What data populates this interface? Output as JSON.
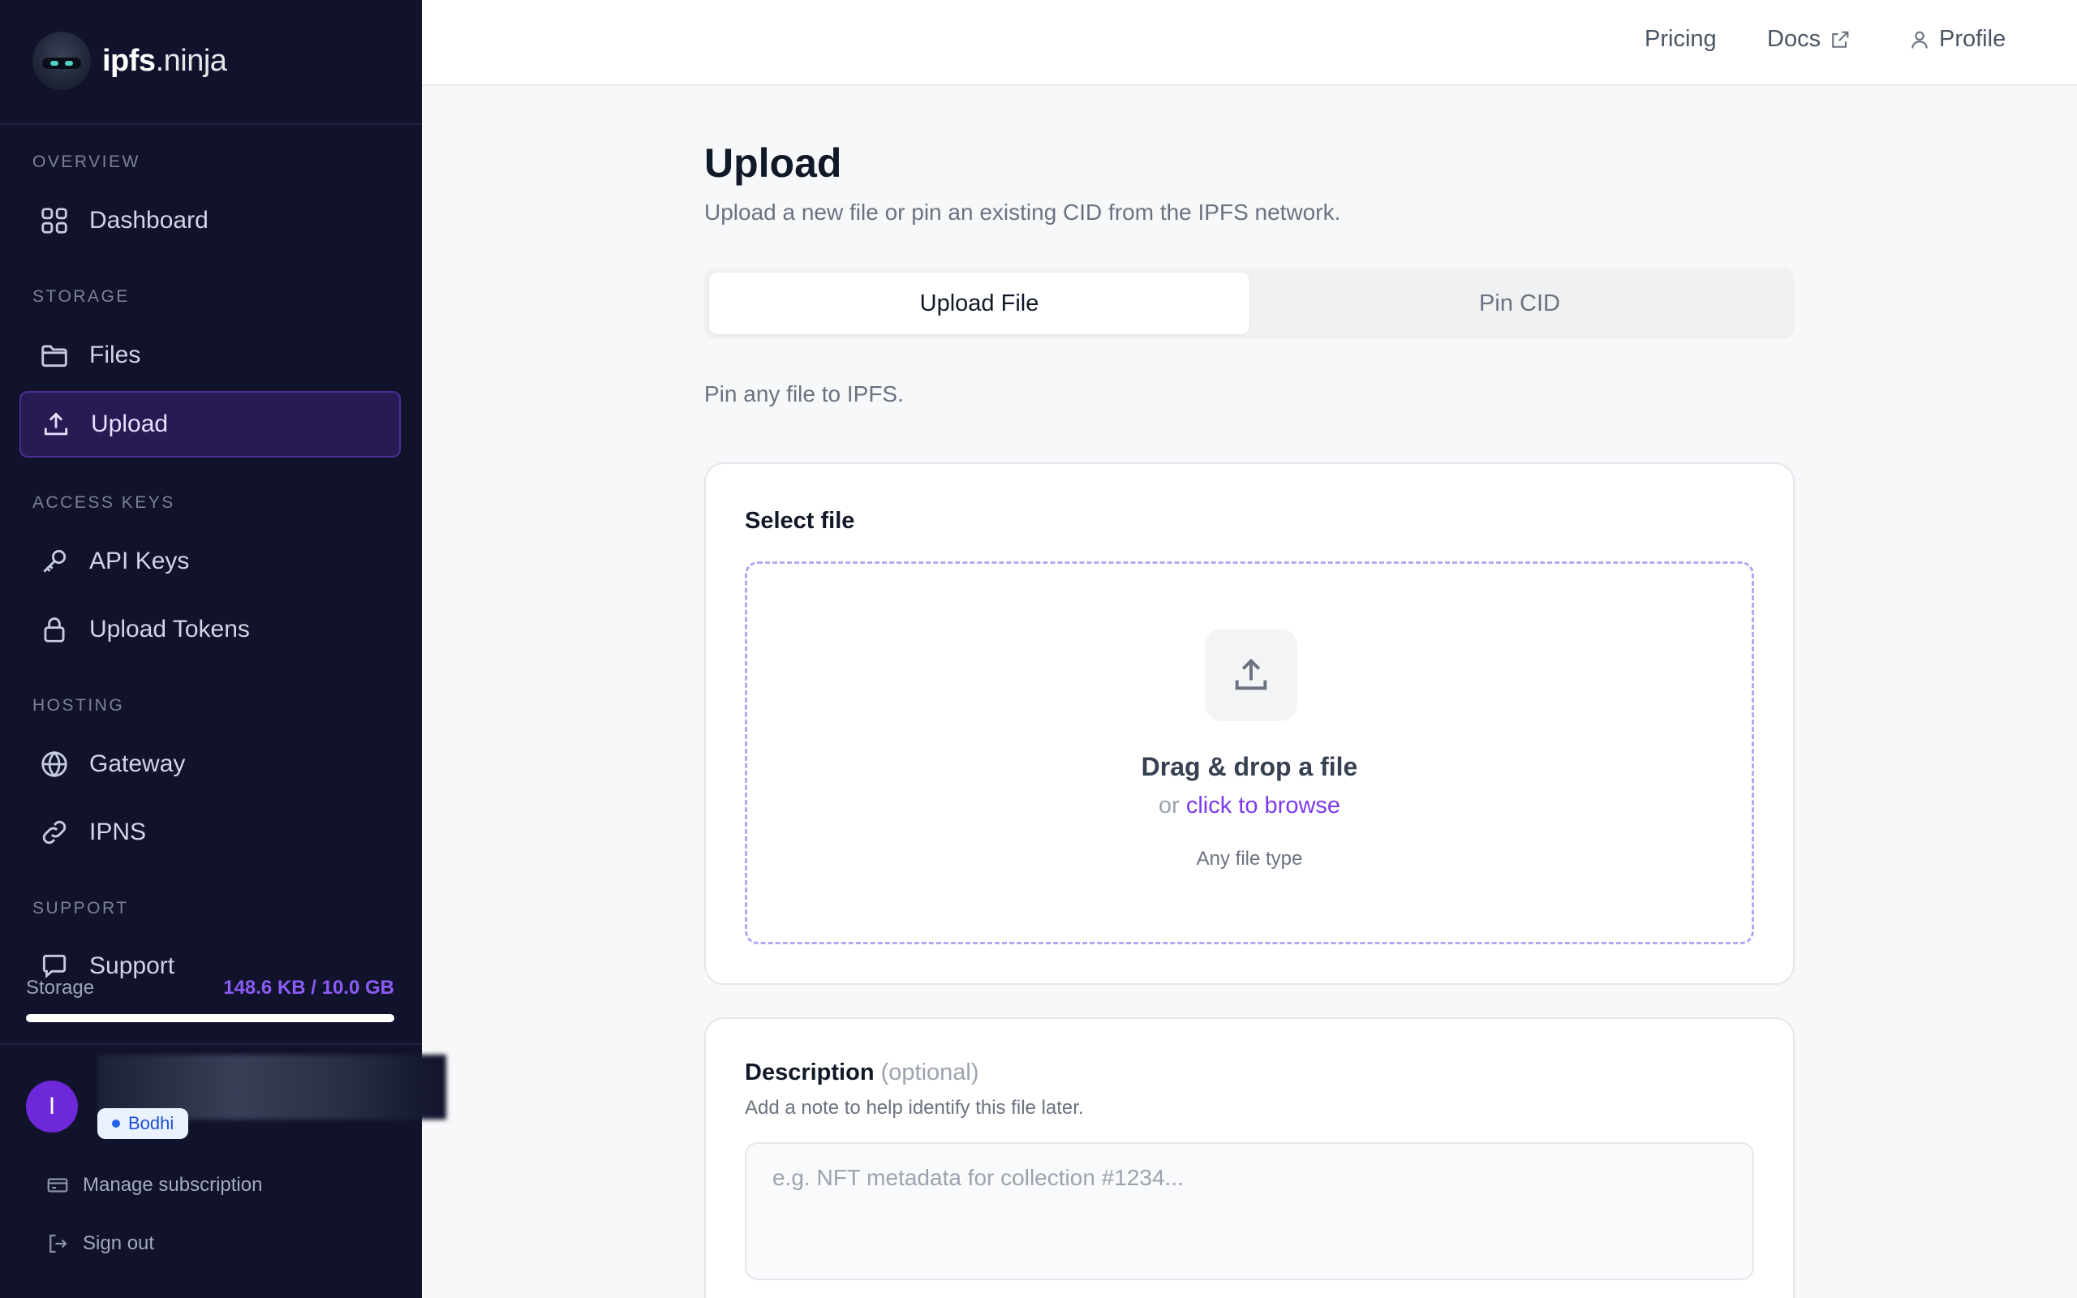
{
  "brand": {
    "name": "ipfs",
    "suffix": ".ninja"
  },
  "sidebar": {
    "sections": [
      {
        "label": "OVERVIEW"
      },
      {
        "label": "STORAGE"
      },
      {
        "label": "ACCESS KEYS"
      },
      {
        "label": "HOSTING"
      },
      {
        "label": "SUPPORT"
      }
    ],
    "items": [
      {
        "label": "Dashboard",
        "icon": "grid-icon"
      },
      {
        "label": "Files",
        "icon": "folder-icon"
      },
      {
        "label": "Upload",
        "icon": "upload-icon",
        "active": true
      },
      {
        "label": "API Keys",
        "icon": "key-icon"
      },
      {
        "label": "Upload Tokens",
        "icon": "lock-icon"
      },
      {
        "label": "Gateway",
        "icon": "globe-icon"
      },
      {
        "label": "IPNS",
        "icon": "link-icon"
      },
      {
        "label": "Support",
        "icon": "chat-icon"
      }
    ],
    "storage": {
      "label": "Storage",
      "value": "148.6 KB / 10.0 GB",
      "used_fraction": 1.45e-05
    },
    "user": {
      "initial": "I",
      "plan": "Bodhi"
    },
    "links": {
      "manage": "Manage subscription",
      "signout": "Sign out"
    }
  },
  "topbar": {
    "pricing": "Pricing",
    "docs": "Docs",
    "profile": "Profile"
  },
  "main": {
    "title": "Upload",
    "subtitle": "Upload a new file or pin an existing CID from the IPFS network.",
    "tabs": [
      {
        "label": "Upload File",
        "active": true
      },
      {
        "label": "Pin CID",
        "active": false
      }
    ],
    "note": "Pin any file to IPFS.",
    "select_card": {
      "title": "Select file",
      "drop_title": "Drag & drop a file",
      "drop_or": "or",
      "drop_link": "click to browse",
      "drop_types": "Any file type"
    },
    "description_card": {
      "title": "Description",
      "optional": "(optional)",
      "help": "Add a note to help identify this file later.",
      "placeholder": "e.g. NFT metadata for collection #1234...",
      "value": ""
    }
  },
  "colors": {
    "accent": "#7c3aed",
    "sidebar_bg": "#10132b",
    "dashed_border": "#b8a6f5"
  }
}
